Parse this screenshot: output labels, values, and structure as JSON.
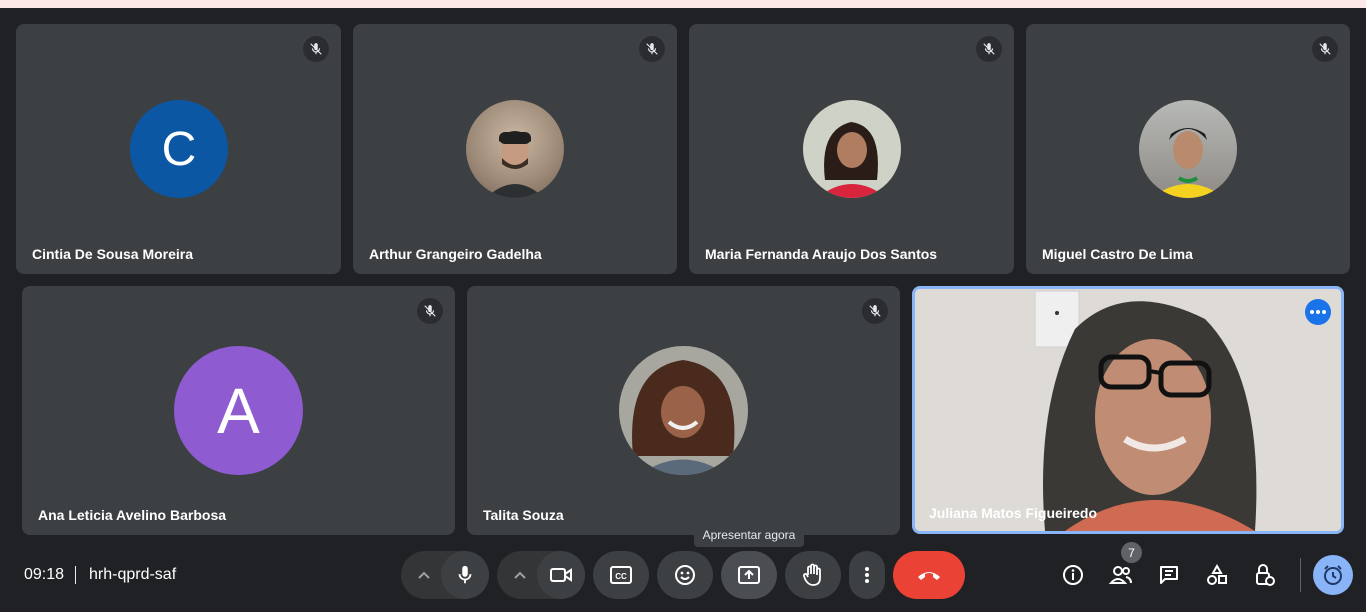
{
  "participants": [
    {
      "name": "Cintia De Sousa Moreira",
      "initial": "C",
      "color": "#0b57a4"
    },
    {
      "name": "Arthur Grangeiro Gadelha"
    },
    {
      "name": "Maria Fernanda Araujo Dos Santos"
    },
    {
      "name": "Miguel Castro De Lima"
    },
    {
      "name": "Ana Leticia Avelino Barbosa",
      "initial": "A",
      "color": "#8e5bd1"
    },
    {
      "name": "Talita Souza"
    },
    {
      "name": "Juliana Matos Figueiredo"
    }
  ],
  "meeting": {
    "time": "09:18",
    "code": "hrh-qprd-saf"
  },
  "tooltip": "Apresentar agora",
  "participant_count": "7",
  "colors": {
    "end_call": "#ea4335",
    "accent": "#8ab4f8",
    "tile": "#3c4043",
    "background": "#202124"
  },
  "icons": [
    "mic-off-icon",
    "mic-icon",
    "camera-icon",
    "captions-icon",
    "emoji-icon",
    "present-icon",
    "raise-hand-icon",
    "more-vert-icon",
    "end-call-icon",
    "info-icon",
    "people-icon",
    "chat-icon",
    "activities-icon",
    "host-controls-icon",
    "timer-icon"
  ]
}
